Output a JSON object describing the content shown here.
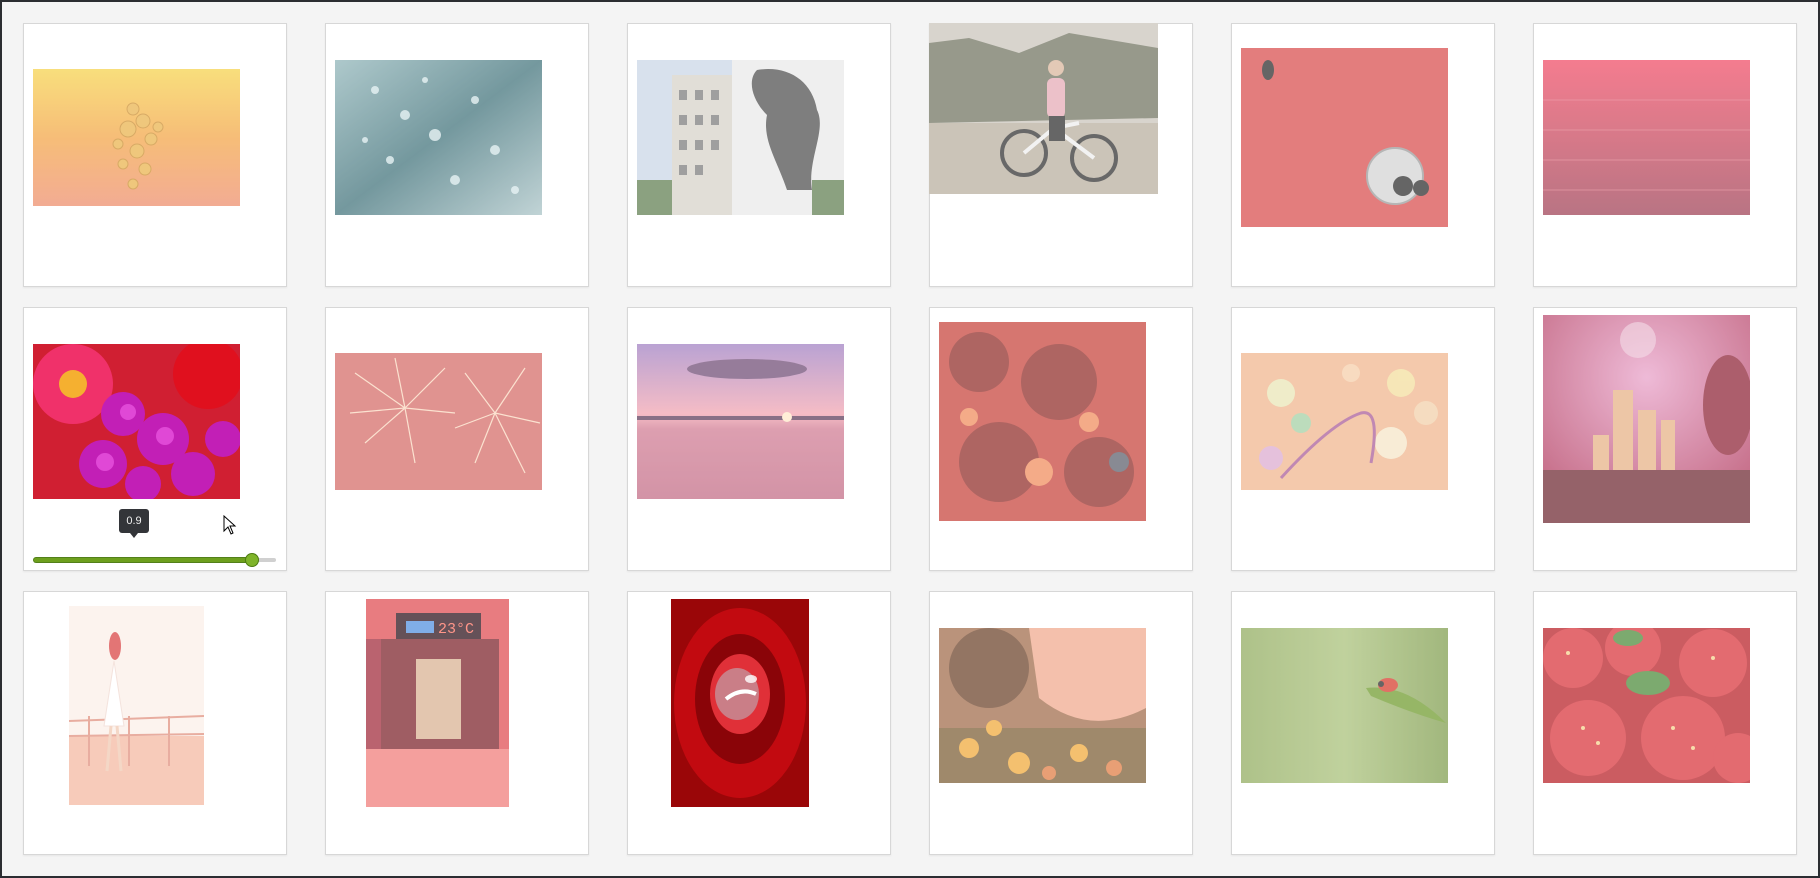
{
  "gallery": {
    "photos": [
      {
        "subject": "bubbles"
      },
      {
        "subject": "water-drops"
      },
      {
        "subject": "astronaut-mural"
      },
      {
        "subject": "cyclist"
      },
      {
        "subject": "red-surface-coin"
      },
      {
        "subject": "red-sea"
      },
      {
        "subject": "flowers"
      },
      {
        "subject": "fireworks"
      },
      {
        "subject": "sunset-sea"
      },
      {
        "subject": "embers"
      },
      {
        "subject": "bokeh-bracelet"
      },
      {
        "subject": "city-night"
      },
      {
        "subject": "dancer"
      },
      {
        "subject": "street-night"
      },
      {
        "subject": "rose"
      },
      {
        "subject": "summer-dress"
      },
      {
        "subject": "ladybug"
      },
      {
        "subject": "strawberries"
      }
    ],
    "opacity_slider": {
      "value": 0.9,
      "value_label": "0.9",
      "min": 0,
      "max": 1,
      "track_color": "#6d9f1d"
    }
  }
}
